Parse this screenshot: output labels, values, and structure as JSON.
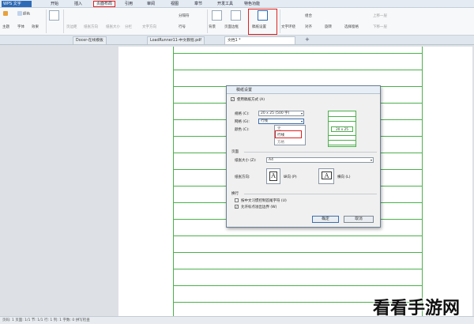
{
  "app": {
    "name": "WPS 文字"
  },
  "menu": {
    "tabs": [
      "开始",
      "插入",
      "页面布局",
      "引用",
      "审阅",
      "视图",
      "章节",
      "开发工具",
      "特色功能"
    ]
  },
  "ribbon": {
    "theme": "主题",
    "font": "字体",
    "effects": "效果",
    "color": "颜色",
    "margins": "页边距",
    "orientation": "纸张方向",
    "size": "纸张大小",
    "columns": "分栏",
    "text_direction": "文字方向",
    "line_numbers": "行号",
    "breaks": "分隔符",
    "background": "背景",
    "page_border": "页面边框",
    "page_setup_grid": "稿纸设置",
    "text_wrap": "文字环绕",
    "align": "对齐",
    "rotate": "旋转",
    "select_pane": "选择窗格",
    "combine": "组合",
    "bring_forward": "上移一层",
    "send_backward": "下移一层"
  },
  "tabs": [
    {
      "label": "Docer-在线模板"
    },
    {
      "label": "LoadRunner11-中文教程.pdf"
    },
    {
      "label": "文档1 *"
    }
  ],
  "dialog": {
    "title": "稿纸设置",
    "use_grid_label": "使用稿纸方式 (A)",
    "spec_label": "规格 (C):",
    "spec_value": "20 x 25 (500 字)",
    "grid_label": "网格 (G):",
    "grid_value": "行线",
    "color_label": "颜色 (C):",
    "dropdown_options": [
      "无",
      "行线",
      "方格"
    ],
    "preview_text": "20 x 25",
    "page_section": "页面",
    "paper_size_label": "纸张大小 (Z):",
    "paper_size_value": "A4",
    "orientation_label": "纸张方向:",
    "portrait_label": "纵向 (P)",
    "landscape_label": "横向 (L)",
    "linebreak_section": "换行",
    "opt_chinese_rule": "按中文习惯控制首尾字符 (U)",
    "opt_punct_overflow": "允许标点溢出边界 (W)",
    "ok": "确定",
    "cancel": "取消"
  },
  "status": {
    "text": "页码: 1   页面: 1/1   节: 1/1   行: 1   列: 1   字数: 0   拼写检查"
  },
  "watermark": "看看手游网",
  "colors": {
    "highlight": "#e02020",
    "grid": "#4cb04c",
    "brand": "#2e6bb7"
  }
}
